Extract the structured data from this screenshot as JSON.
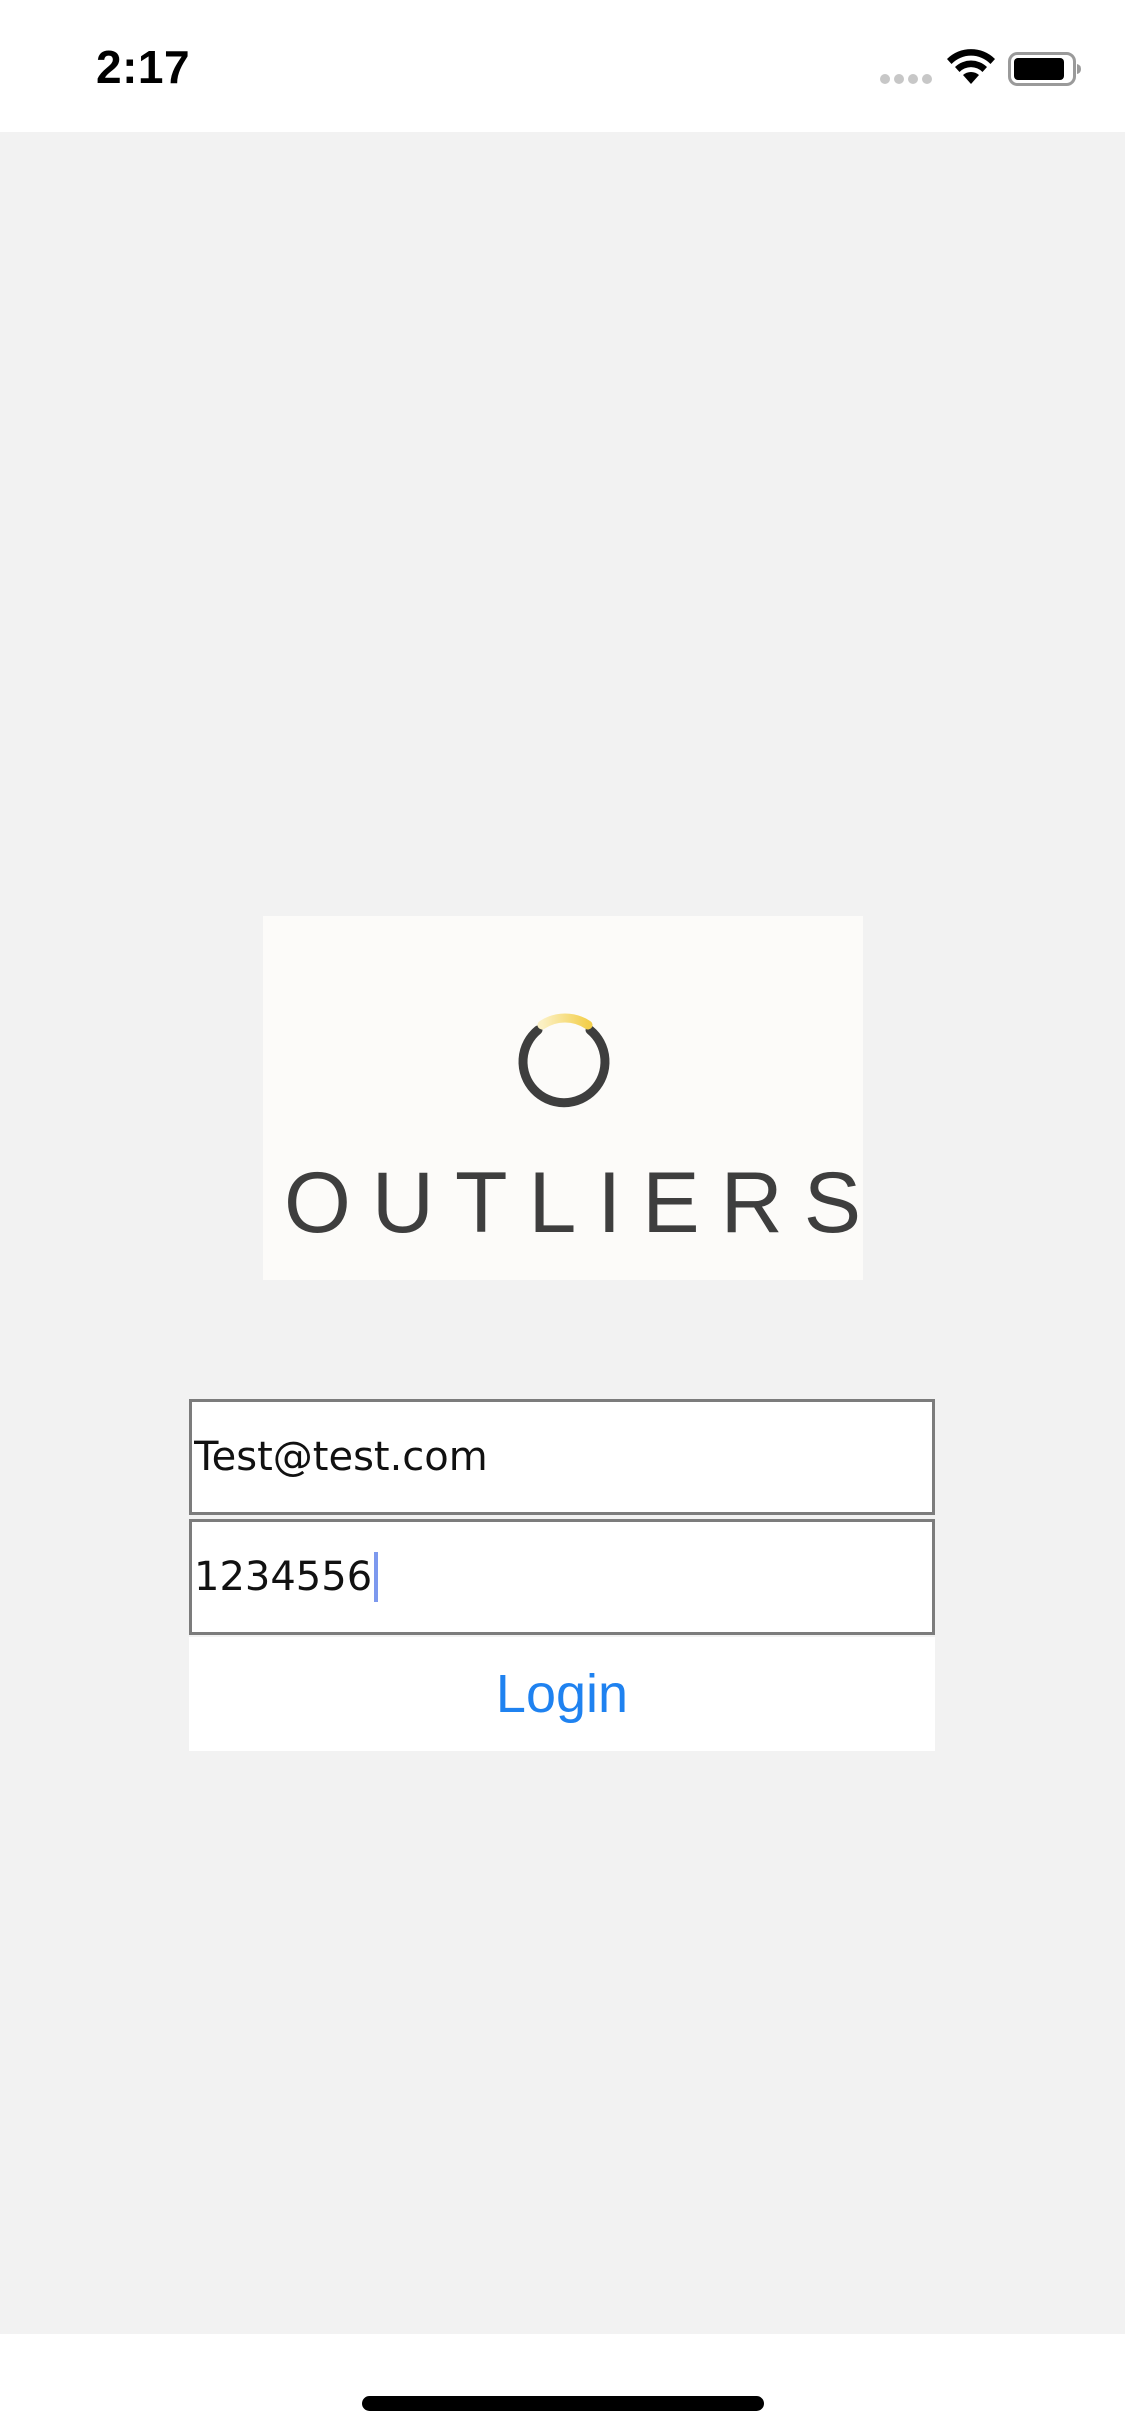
{
  "status_bar": {
    "time": "2:17",
    "icons": [
      "cellular-signal-icon",
      "wifi-icon",
      "battery-icon"
    ]
  },
  "logo": {
    "wordmark": "OUTLIERS",
    "mark_icon": "ring-logo-icon",
    "colors": {
      "ring": "#3e3e3e",
      "accent": "#f5d45e",
      "card_background": "#fcfbf9"
    }
  },
  "form": {
    "email": {
      "value": "Test@test.com"
    },
    "password": {
      "value": "1234556"
    },
    "login_label": "Login"
  },
  "colors": {
    "background": "#f2f2f2",
    "link_blue": "#1f82f0",
    "field_border": "#7c7c7c",
    "caret": "#7d99ee"
  }
}
